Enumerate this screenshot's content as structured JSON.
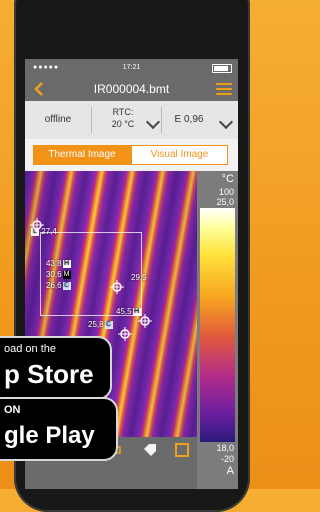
{
  "status_bar": {
    "time": "17:21"
  },
  "nav": {
    "title": "IR000004.bmt"
  },
  "info": {
    "connection": "offline",
    "rtc_label": "RTC:",
    "rtc_value": "20 °C",
    "emissivity": "E 0,96"
  },
  "tabs": [
    {
      "label": "Thermal Image"
    },
    {
      "label": "Visual Image"
    }
  ],
  "measurements": {
    "left_marker": {
      "tag": "L",
      "value": "27,4"
    },
    "stats": [
      {
        "value": "43,8",
        "tag": "H"
      },
      {
        "value": "30,6",
        "tag": "M"
      },
      {
        "value": "26,6",
        "tag": "C"
      }
    ],
    "spot1": "29,5",
    "spot2": {
      "value": "45,5",
      "tag": "H"
    },
    "spot3": {
      "value": "25,8",
      "tag": "C"
    }
  },
  "scale": {
    "unit": "°C",
    "max": "100",
    "top": "25,0",
    "bottom": "18,0",
    "min": "-20",
    "mode": "A"
  },
  "toolbar": {
    "icons": [
      "settings-icon",
      "tools-icon",
      "zoom-icon",
      "tag-icon",
      "frame-icon"
    ]
  },
  "badges": {
    "app_store": {
      "line1": "oad on the",
      "line2": "p Store"
    },
    "google_play": {
      "line1": "ON",
      "line2": "gle Play"
    }
  },
  "colors": {
    "accent": "#f29318",
    "background": "#f09a1f"
  }
}
